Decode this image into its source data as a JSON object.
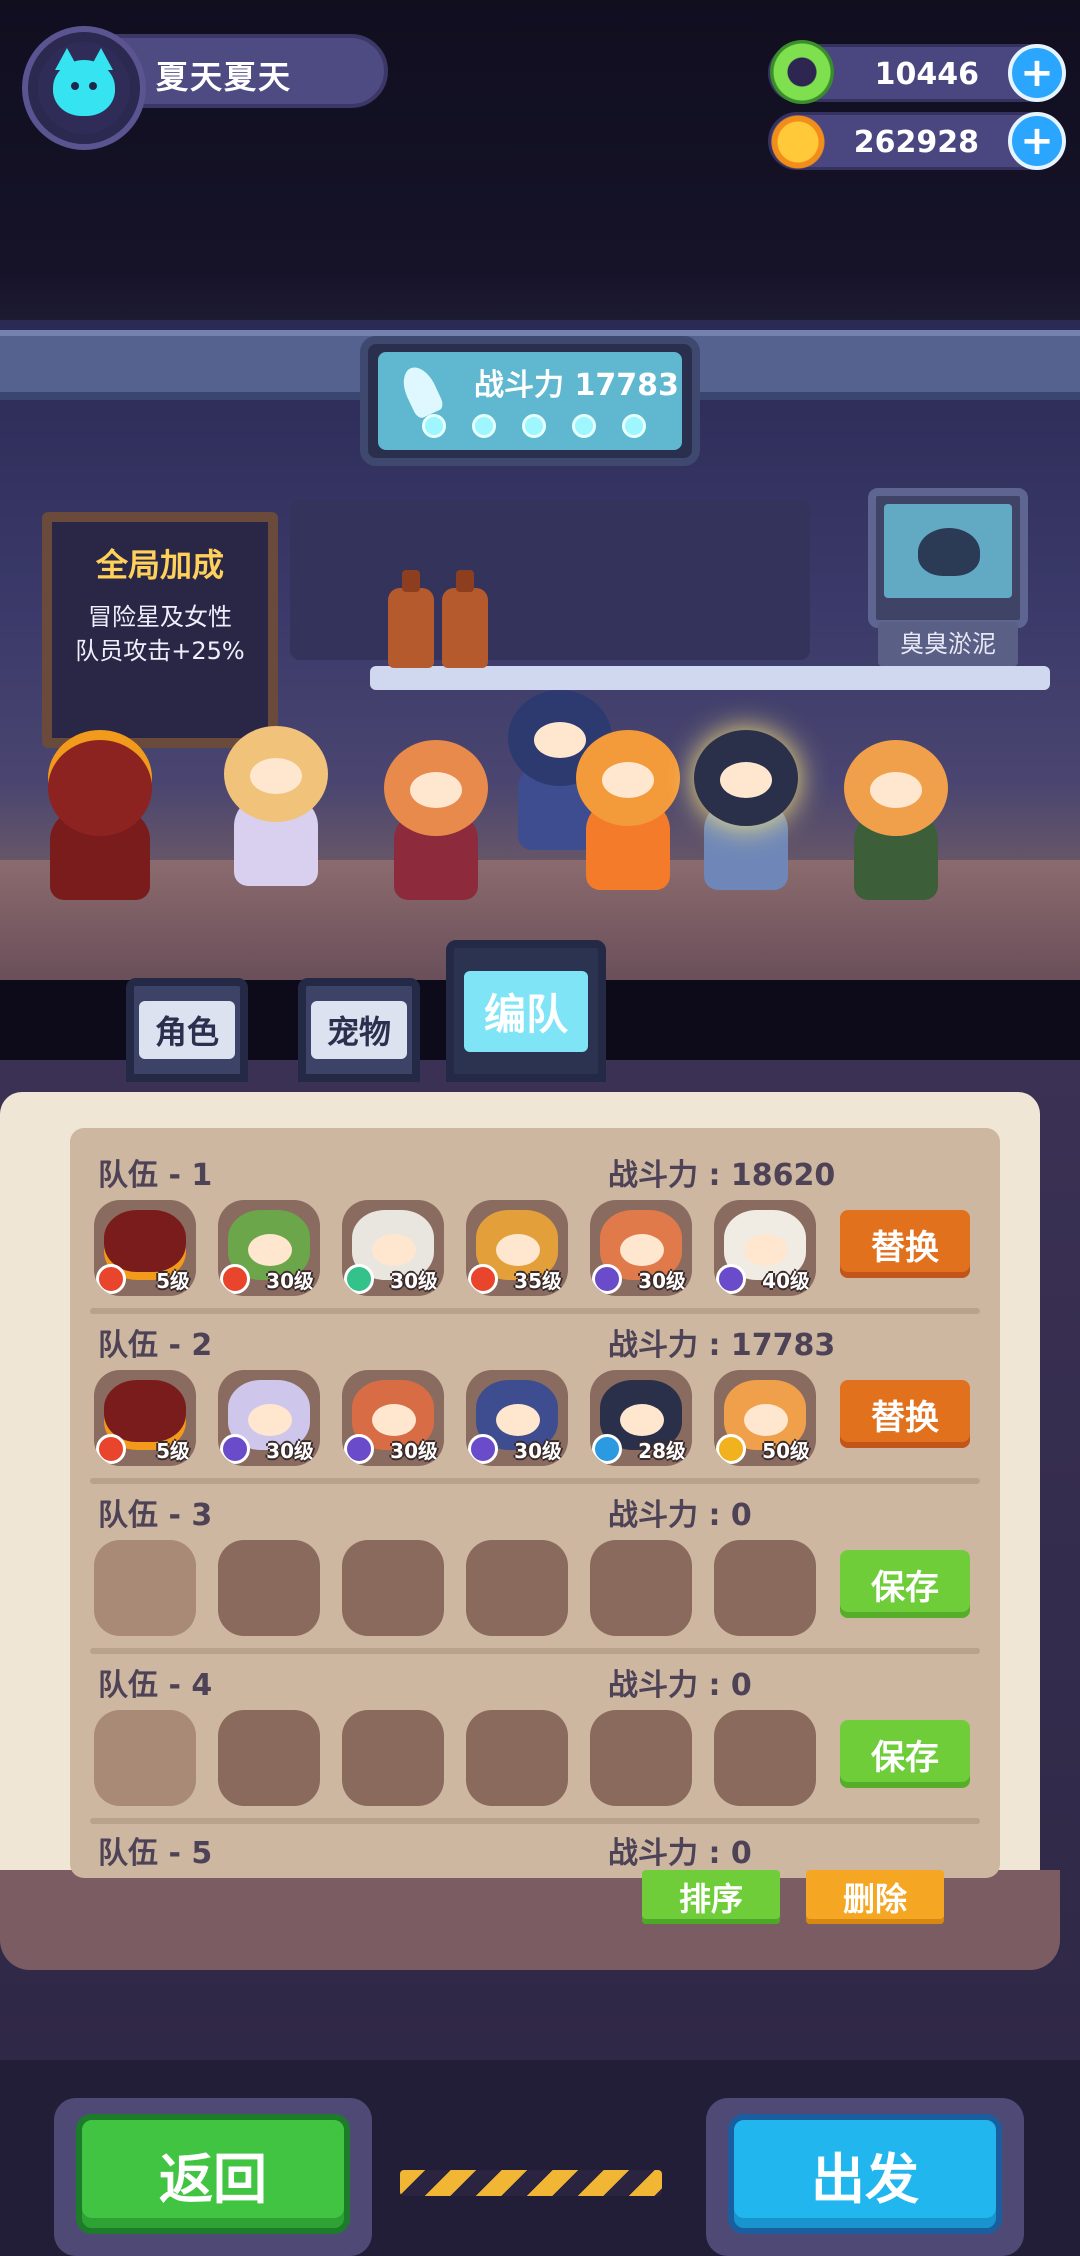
{
  "player": {
    "name": "夏天夏天",
    "avatar_icon": "cat-icon"
  },
  "currencies": [
    {
      "name": "gem",
      "value": "10446",
      "icon": "donut-gem-icon",
      "color": "#6fd04a"
    },
    {
      "name": "coin",
      "value": "262928",
      "icon": "planet-coin-icon",
      "color": "#f5a623"
    }
  ],
  "power_panel": {
    "label": "战斗力 17783",
    "dots": 5
  },
  "buff_board": {
    "title": "全局加成",
    "line1": "冒险星及女性",
    "line2": "队员攻击+25%"
  },
  "monitor": {
    "label": "臭臭淤泥"
  },
  "tabs": [
    {
      "label": "角色",
      "active": false
    },
    {
      "label": "宠物",
      "active": false
    },
    {
      "label": "编队",
      "active": true
    }
  ],
  "teams": [
    {
      "title": "队伍 - 1",
      "power": "战斗力 : 18620",
      "button": "替换",
      "button_type": "replace",
      "members": [
        {
          "level": "5级",
          "element": "fire"
        },
        {
          "level": "30级",
          "element": "fire"
        },
        {
          "level": "30级",
          "element": "wind"
        },
        {
          "level": "35级",
          "element": "fire"
        },
        {
          "level": "30级",
          "element": "dark"
        },
        {
          "level": "40级",
          "element": "dark"
        }
      ]
    },
    {
      "title": "队伍 - 2",
      "power": "战斗力 : 17783",
      "button": "替换",
      "button_type": "replace",
      "members": [
        {
          "level": "5级",
          "element": "fire"
        },
        {
          "level": "30级",
          "element": "dark"
        },
        {
          "level": "30级",
          "element": "dark"
        },
        {
          "level": "30级",
          "element": "dark"
        },
        {
          "level": "28级",
          "element": "water"
        },
        {
          "level": "50级",
          "element": "light"
        }
      ]
    },
    {
      "title": "队伍 - 3",
      "power": "战斗力 : 0",
      "button": "保存",
      "button_type": "save",
      "members": []
    },
    {
      "title": "队伍 - 4",
      "power": "战斗力 : 0",
      "button": "保存",
      "button_type": "save",
      "members": []
    },
    {
      "title": "队伍 - 5",
      "power": "战斗力 : 0"
    }
  ],
  "book_actions": {
    "sort": "排序",
    "delete": "删除"
  },
  "bottom": {
    "back": "返回",
    "go": "出发"
  },
  "colors": {
    "fire": "#e8452c",
    "wind": "#33c28a",
    "dark": "#6a4bc9",
    "water": "#2c9ae0",
    "light": "#f2b21d",
    "accent_orange": "#e2711e",
    "accent_green": "#6fcd3a",
    "accent_blue": "#22b6ee"
  }
}
